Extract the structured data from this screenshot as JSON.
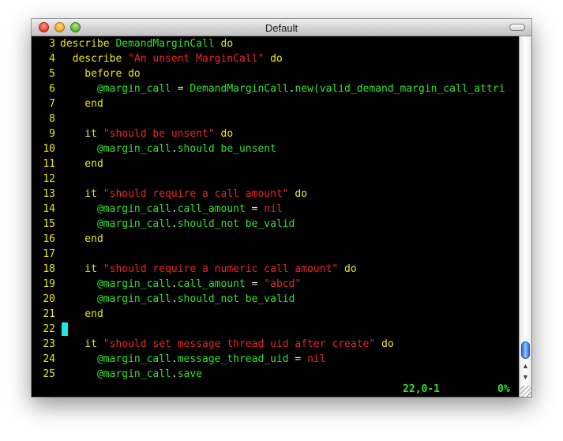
{
  "window": {
    "title": "Default"
  },
  "lines": [
    {
      "num": "3",
      "parts": [
        [
          "kw",
          "describe "
        ],
        [
          "cls",
          "DemandMarginCall"
        ],
        [
          "kw",
          " do"
        ]
      ]
    },
    {
      "num": "4",
      "parts": [
        [
          "kw",
          "  describe "
        ],
        [
          "str",
          "\"An unsent MarginCall\""
        ],
        [
          "kw",
          " do"
        ]
      ]
    },
    {
      "num": "5",
      "parts": [
        [
          "kw",
          "    before do"
        ]
      ]
    },
    {
      "num": "6",
      "parts": [
        [
          "ivar",
          "      @margin_call"
        ],
        [
          "wht",
          " = "
        ],
        [
          "cls",
          "DemandMarginCall"
        ],
        [
          "wht",
          "."
        ],
        [
          "cls",
          "new(valid_demand_margin_call_attri"
        ]
      ]
    },
    {
      "num": "7",
      "parts": [
        [
          "kw",
          "    end"
        ]
      ]
    },
    {
      "num": "8",
      "parts": []
    },
    {
      "num": "9",
      "parts": [
        [
          "kw",
          "    it "
        ],
        [
          "str",
          "\"should be unsent\""
        ],
        [
          "kw",
          " do"
        ]
      ]
    },
    {
      "num": "10",
      "parts": [
        [
          "ivar",
          "      @margin_call"
        ],
        [
          "wht",
          "."
        ],
        [
          "cls",
          "should be_unsent"
        ]
      ]
    },
    {
      "num": "11",
      "parts": [
        [
          "kw",
          "    end"
        ]
      ]
    },
    {
      "num": "12",
      "parts": []
    },
    {
      "num": "13",
      "parts": [
        [
          "kw",
          "    it "
        ],
        [
          "str",
          "\"should require a call amount\""
        ],
        [
          "kw",
          " do"
        ]
      ]
    },
    {
      "num": "14",
      "parts": [
        [
          "ivar",
          "      @margin_call"
        ],
        [
          "wht",
          "."
        ],
        [
          "cls",
          "call_amount"
        ],
        [
          "wht",
          " = "
        ],
        [
          "str",
          "nil"
        ]
      ]
    },
    {
      "num": "15",
      "parts": [
        [
          "ivar",
          "      @margin_call"
        ],
        [
          "wht",
          "."
        ],
        [
          "cls",
          "should_not be_valid"
        ]
      ]
    },
    {
      "num": "16",
      "parts": [
        [
          "kw",
          "    end"
        ]
      ]
    },
    {
      "num": "17",
      "parts": []
    },
    {
      "num": "18",
      "parts": [
        [
          "kw",
          "    it "
        ],
        [
          "str",
          "\"should require a numeric call amount\""
        ],
        [
          "kw",
          " do"
        ]
      ]
    },
    {
      "num": "19",
      "parts": [
        [
          "ivar",
          "      @margin_call"
        ],
        [
          "wht",
          "."
        ],
        [
          "cls",
          "call_amount"
        ],
        [
          "wht",
          " = "
        ],
        [
          "str",
          "\"abcd\""
        ]
      ]
    },
    {
      "num": "20",
      "parts": [
        [
          "ivar",
          "      @margin_call"
        ],
        [
          "wht",
          "."
        ],
        [
          "cls",
          "should_not be_valid"
        ]
      ]
    },
    {
      "num": "21",
      "parts": [
        [
          "kw",
          "    end"
        ]
      ]
    },
    {
      "num": "22",
      "parts": [],
      "cursor": true
    },
    {
      "num": "23",
      "parts": [
        [
          "kw",
          "    it "
        ],
        [
          "str",
          "\"should set message thread uid after create\""
        ],
        [
          "kw",
          " do"
        ]
      ]
    },
    {
      "num": "24",
      "parts": [
        [
          "ivar",
          "      @margin_call"
        ],
        [
          "wht",
          "."
        ],
        [
          "cls",
          "message_thread_uid"
        ],
        [
          "wht",
          " = "
        ],
        [
          "str",
          "nil"
        ]
      ]
    },
    {
      "num": "25",
      "parts": [
        [
          "ivar",
          "      @margin_call"
        ],
        [
          "wht",
          "."
        ],
        [
          "cls",
          "save"
        ]
      ]
    }
  ],
  "status": {
    "position": "22,0-1",
    "percent": "0%"
  },
  "colors": {
    "keyword": "#e6e61e",
    "constant": "#2ee02e",
    "string": "#e8222a",
    "cursor": "#22e6e6"
  }
}
